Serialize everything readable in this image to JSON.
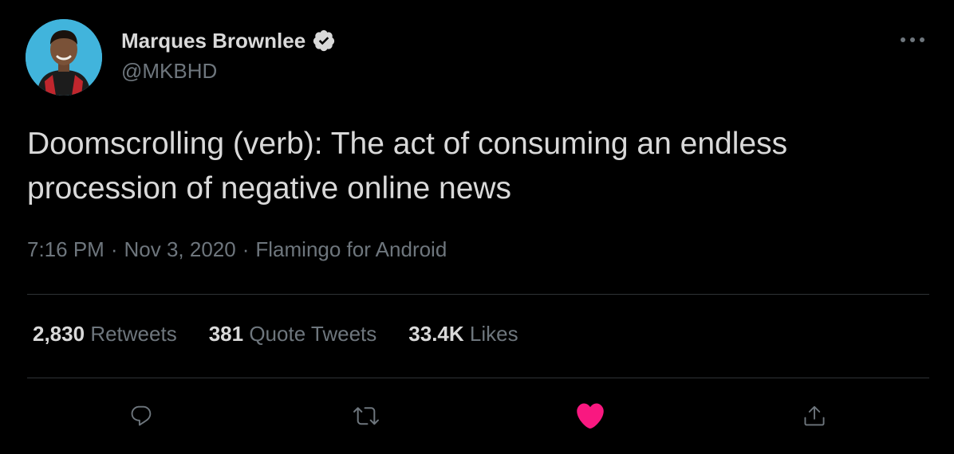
{
  "author": {
    "display_name": "Marques Brownlee",
    "handle": "@MKBHD",
    "verified": true,
    "avatar": "profile-photo"
  },
  "tweet": {
    "text": "Doomscrolling (verb): The act of consuming an endless procession of negative online news",
    "time": "7:16 PM",
    "date": "Nov 3, 2020",
    "source": "Flamingo for Android",
    "separator": "·"
  },
  "stats": {
    "retweets_count": "2,830",
    "retweets_label": "Retweets",
    "quotes_count": "381",
    "quotes_label": "Quote Tweets",
    "likes_count": "33.4K",
    "likes_label": "Likes"
  },
  "actions": {
    "reply": "reply-icon",
    "retweet": "retweet-icon",
    "like": "heart-icon",
    "share": "share-icon",
    "liked": true
  },
  "colors": {
    "background": "#000000",
    "text_primary": "#d9d9d9",
    "text_secondary": "#6e767d",
    "divider": "#2f3336",
    "like_active": "#f91880",
    "verified_badge": "#d9d9d9"
  }
}
